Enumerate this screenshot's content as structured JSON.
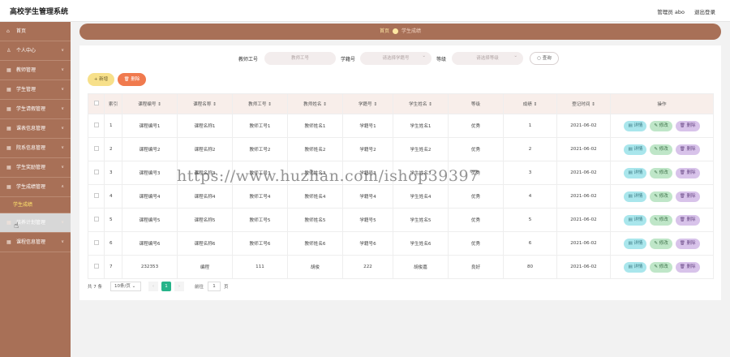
{
  "header": {
    "title": "高校学生管理系统",
    "user": "管理员 abo",
    "logout": "退出登录"
  },
  "sidebar": {
    "items": [
      {
        "label": "首页",
        "icon": "home-icon"
      },
      {
        "label": "个人中心",
        "icon": "user-icon"
      },
      {
        "label": "教师管理",
        "icon": "grid-icon"
      },
      {
        "label": "学生管理",
        "icon": "grid-icon"
      },
      {
        "label": "学生请假管理",
        "icon": "grid-icon"
      },
      {
        "label": "课表信息管理",
        "icon": "grid-icon"
      },
      {
        "label": "院系信息管理",
        "icon": "grid-icon"
      },
      {
        "label": "学生奖励管理",
        "icon": "grid-icon"
      },
      {
        "label": "学生成绩管理",
        "icon": "grid-icon"
      },
      {
        "label": "学生成绩",
        "icon": ""
      },
      {
        "label": "培养计划管理",
        "icon": "grid-icon"
      },
      {
        "label": "课程信息管理",
        "icon": "grid-icon"
      }
    ]
  },
  "breadcrumb": {
    "home": "首页",
    "current": "学生成绩"
  },
  "search": {
    "teacher_label": "教师工号",
    "teacher_placeholder": "教师工号",
    "student_label": "学籍号",
    "student_placeholder": "请选择学籍号",
    "grade_label": "等级",
    "grade_placeholder": "请选择等级",
    "search_button": "查询"
  },
  "toolbar": {
    "add": "+ 新增",
    "delete": "删除"
  },
  "table": {
    "headers": [
      "索引",
      "课程编号",
      "课程名称",
      "教师工号",
      "教师姓名",
      "学籍号",
      "学生姓名",
      "等级",
      "成绩",
      "登记时间",
      "操作"
    ],
    "rows": [
      [
        "1",
        "课程编号1",
        "课程名称1",
        "教师工号1",
        "教师姓名1",
        "学籍号1",
        "学生姓名1",
        "优秀",
        "1",
        "2021-06-02"
      ],
      [
        "2",
        "课程编号2",
        "课程名称2",
        "教师工号2",
        "教师姓名2",
        "学籍号2",
        "学生姓名2",
        "优秀",
        "2",
        "2021-06-02"
      ],
      [
        "3",
        "课程编号3",
        "课程名称3",
        "教师工号3",
        "教师姓名3",
        "学籍号3",
        "学生姓名3",
        "优秀",
        "3",
        "2021-06-02"
      ],
      [
        "4",
        "课程编号4",
        "课程名称4",
        "教师工号4",
        "教师姓名4",
        "学籍号4",
        "学生姓名4",
        "优秀",
        "4",
        "2021-06-02"
      ],
      [
        "5",
        "课程编号5",
        "课程名称5",
        "教师工号5",
        "教师姓名5",
        "学籍号5",
        "学生姓名5",
        "优秀",
        "5",
        "2021-06-02"
      ],
      [
        "6",
        "课程编号6",
        "课程名称6",
        "教师工号6",
        "教师姓名6",
        "学籍号6",
        "学生姓名6",
        "优秀",
        "6",
        "2021-06-02"
      ],
      [
        "7",
        "232353",
        "编程",
        "111",
        "胡俊",
        "222",
        "胡俊嘉",
        "良好",
        "80",
        "2021-06-02"
      ]
    ],
    "actions": {
      "detail": "详情",
      "edit": "修改",
      "delete": "删除"
    }
  },
  "pagination": {
    "total": "共 7 条",
    "page_size": "10条/页",
    "prev": "‹",
    "current": "1",
    "next": "›",
    "goto": "前往",
    "goto_value": "1",
    "page_unit": "页"
  },
  "watermark": "https://www.huzhan.com/ishop39397",
  "colors": {
    "sidebar": "#a87057",
    "accent": "#27b48a",
    "add": "#f7e08a",
    "delete": "#f07a4e"
  }
}
